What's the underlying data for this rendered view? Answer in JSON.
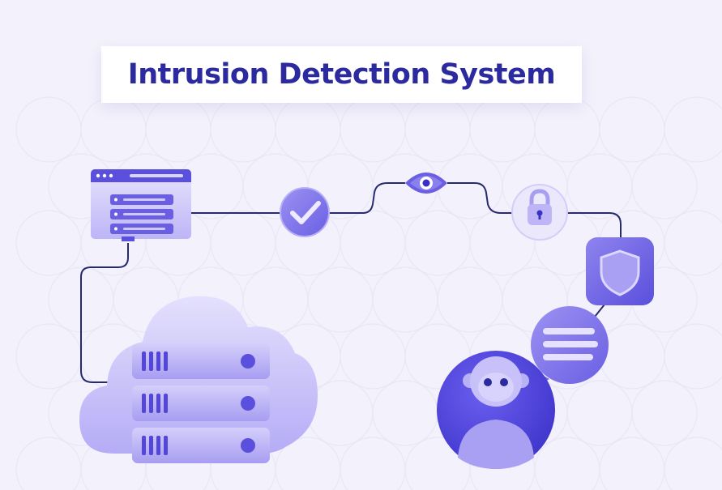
{
  "title": "Intrusion Detection System",
  "colors": {
    "background": "#f3f1fb",
    "title_text": "#2b2a9e",
    "line": "#262a6e",
    "accent_dark": "#4a3fd6",
    "accent_mid": "#8b80ef",
    "accent_light": "#c7c1f8"
  },
  "diagram": {
    "nodes": [
      {
        "id": "server-monitor",
        "icon": "server-monitor-icon"
      },
      {
        "id": "verified",
        "icon": "checkmark-icon"
      },
      {
        "id": "monitoring",
        "icon": "eye-icon"
      },
      {
        "id": "lock",
        "icon": "padlock-icon"
      },
      {
        "id": "protection",
        "icon": "shield-icon"
      },
      {
        "id": "assistant",
        "icon": "robot-chat-icon"
      },
      {
        "id": "cloud-storage",
        "icon": "cloud-server-icon"
      }
    ]
  }
}
